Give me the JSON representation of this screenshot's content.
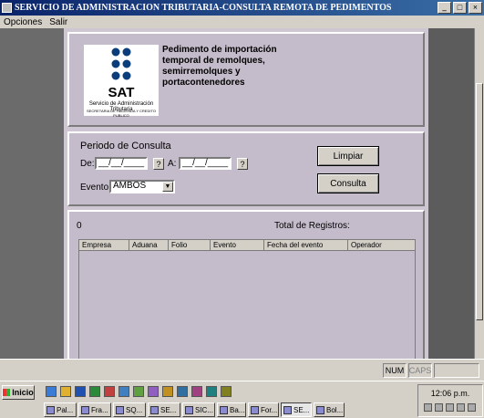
{
  "window": {
    "title": "SERVICIO DE ADMINISTRACION TRIBUTARIA-CONSULTA REMOTA DE PEDIMENTOS"
  },
  "menu": {
    "items": [
      "Opciones",
      "Salir"
    ]
  },
  "header": {
    "logo_text": "SAT",
    "logo_subtitle": "Servicio de Administración Tributaria",
    "logo_subtitle2": "SECRETARIA DE HACIENDA Y CREDITO PUBLICO",
    "title": "Pedimento de importación temporal de remolques, semirremolques y portacontenedores"
  },
  "consulta": {
    "section_label": "Periodo de Consulta",
    "de_label": "De:",
    "de_value": "__/__/____",
    "a_label": "A:",
    "a_value": "__/__/____",
    "help_label": "?",
    "evento_label": "Evento:",
    "evento_value": "AMBOS",
    "limpiar_label": "Limpiar",
    "consulta_label": "Consulta"
  },
  "results": {
    "count": "0",
    "total_label": "Total de Registros:",
    "columns": [
      "Empresa",
      "Aduana",
      "Folio",
      "Evento",
      "Fecha del evento",
      "Operador"
    ]
  },
  "statusbar": {
    "num": "NUM",
    "caps": "CAPS"
  },
  "taskbar": {
    "start_label": "Inicio",
    "tasks": [
      "Pal...",
      "Fra...",
      "SQ...",
      "SE...",
      "SIC...",
      "Ba...",
      "For...",
      "SE...",
      "Bol..."
    ],
    "clock": "12:06 p.m."
  }
}
